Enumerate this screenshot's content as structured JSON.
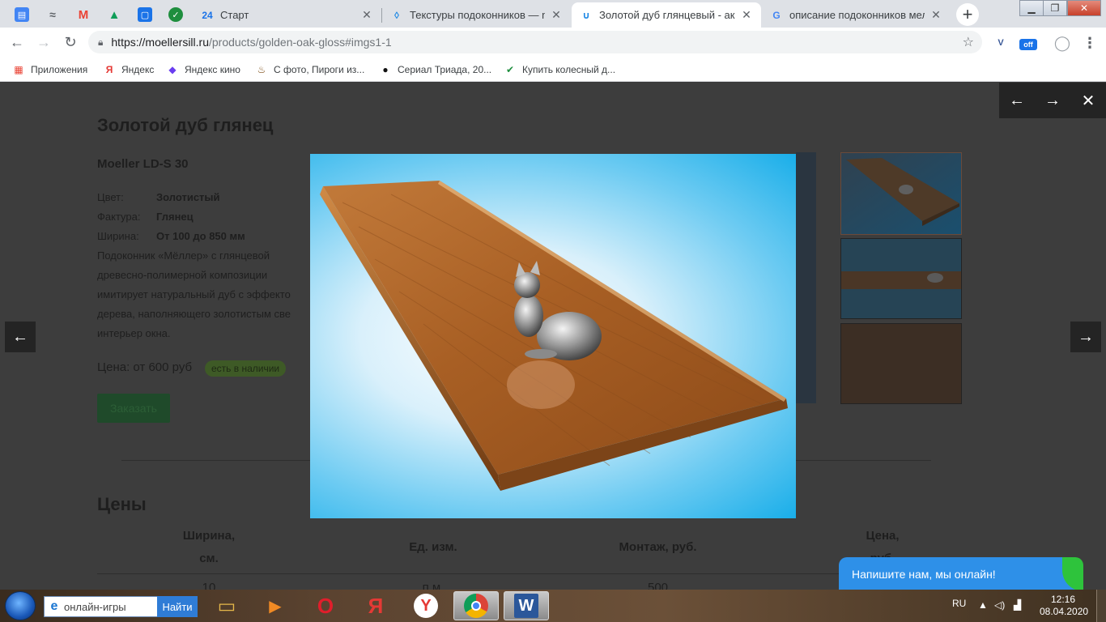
{
  "browser": {
    "pinned_tabs": [
      {
        "name": "google-docs-tab",
        "icon": "docs-icon",
        "color": "#4285f4",
        "glyph": "▤"
      },
      {
        "name": "analytics-tab",
        "icon": "trend-icon",
        "color": "#5f6368",
        "glyph": "≈"
      },
      {
        "name": "gmail-tab",
        "icon": "gmail-icon",
        "color": "#ea4335",
        "glyph": "M"
      },
      {
        "name": "drive-tab",
        "icon": "drive-icon",
        "color": "#0f9d58",
        "glyph": "▲"
      },
      {
        "name": "messages-tab",
        "icon": "chat-icon",
        "color": "#1a73e8",
        "glyph": "▢"
      },
      {
        "name": "check-tab",
        "icon": "check-icon",
        "color": "#1e8e3e",
        "glyph": "✓"
      }
    ],
    "tabs": [
      {
        "title": "Старт",
        "icon": "24-icon",
        "glyph": "24",
        "color": "#1a73e8",
        "active": false
      },
      {
        "title": "Текстуры подоконников — mo",
        "icon": "drop-icon",
        "glyph": "◊",
        "color": "#1e88e5",
        "active": false
      },
      {
        "title": "Золотой дуб глянцевый - акри",
        "icon": "moeller-icon",
        "glyph": "∪",
        "color": "#1e88e5",
        "active": true
      },
      {
        "title": "описание подоконников мелле",
        "icon": "google-icon",
        "glyph": "G",
        "color": "#4285f4",
        "active": false
      }
    ],
    "new_tab_label": "+",
    "window_controls": {
      "minimize": "▁",
      "maximize": "❐",
      "close": "✕"
    },
    "url": {
      "host": "https://moellersill.ru",
      "path": "/products/golden-oak-gloss#imgs1-1"
    },
    "extensions": [
      {
        "name": "extension-v-icon",
        "glyph": "V",
        "color": "#3b5998"
      },
      {
        "name": "extension-off-icon",
        "glyph": "off",
        "color": "#1a73e8"
      },
      {
        "name": "profile-avatar-icon",
        "glyph": "◯",
        "color": "#9aa0a6"
      },
      {
        "name": "menu-icon",
        "glyph": "⋮",
        "color": "#5f6368"
      }
    ],
    "bookmarks": [
      {
        "label": "Приложения",
        "icon": "apps-grid-icon",
        "glyph": "▦",
        "color": "#ea4335"
      },
      {
        "label": "Яндекс",
        "icon": "yandex-icon",
        "glyph": "Я",
        "color": "#e53935"
      },
      {
        "label": "Яндекс кино",
        "icon": "yandex-kino-icon",
        "glyph": "◆",
        "color": "#6a3df0"
      },
      {
        "label": "С фото, Пироги из...",
        "icon": "pie-icon",
        "glyph": "♨",
        "color": "#7b4a12"
      },
      {
        "label": "Сериал Триада, 20...",
        "icon": "tv-icon",
        "glyph": "●",
        "color": "#111111"
      },
      {
        "label": "Купить колесный д...",
        "icon": "check-circle-icon",
        "glyph": "✔",
        "color": "#1e8e3e"
      }
    ]
  },
  "product": {
    "title": "Золотой дуб глянец",
    "model": "Moeller LD-S 30",
    "specs": [
      {
        "key": "Цвет:",
        "value": "Золотистый"
      },
      {
        "key": "Фактура:",
        "value": "Глянец"
      },
      {
        "key": "Ширина:",
        "value": "От 100 до 850 мм"
      }
    ],
    "description_lines": [
      "Подоконник «Мёллер» с глянцевой",
      "древесно-полимерной композиции",
      "имитирует натуральный дуб с эффекто",
      "дерева, наполняющего золотистым све",
      "интерьер окна."
    ],
    "price": "Цена: от 600 руб",
    "stock_badge": "есть в наличии",
    "order_button": "Заказать",
    "prices_title": "Цены",
    "table": {
      "headers": [
        "Ширина,\nсм.",
        "Ед. изм.",
        "Монтаж, руб.",
        "Цена,\nруб."
      ],
      "row": [
        "10",
        "п.м.",
        "500",
        ""
      ]
    }
  },
  "lightbox": {
    "prev": "←",
    "next": "→",
    "close": "✕",
    "side_prev": "←",
    "side_next": "→"
  },
  "chat": {
    "label": "Напишите нам, мы онлайн!"
  },
  "taskbar": {
    "search_value": "онлайн-игры",
    "search_button": "Найти",
    "apps": [
      {
        "name": "explorer-app",
        "icon": "folder-icon",
        "color": "#e6b84a",
        "glyph": "▭",
        "active": false
      },
      {
        "name": "media-player-app",
        "icon": "media-player-icon",
        "color": "#f08a24",
        "glyph": "▶",
        "active": false
      },
      {
        "name": "opera-app",
        "icon": "opera-icon",
        "color": "#e01e2b",
        "glyph": "O",
        "active": false
      },
      {
        "name": "yandex-app",
        "icon": "yandex-icon",
        "color": "#e53935",
        "glyph": "Я",
        "active": false
      },
      {
        "name": "yandex-browser-app",
        "icon": "yandex-browser-icon",
        "color": "#e53935",
        "glyph": "Y",
        "active": false
      },
      {
        "name": "chrome-app",
        "icon": "chrome-icon",
        "color": "#4285f4",
        "glyph": "◉",
        "active": true
      },
      {
        "name": "word-app",
        "icon": "word-icon",
        "color": "#2b579a",
        "glyph": "W",
        "active": true
      }
    ],
    "lang": "RU",
    "time": "12:16",
    "date": "08.04.2020"
  }
}
